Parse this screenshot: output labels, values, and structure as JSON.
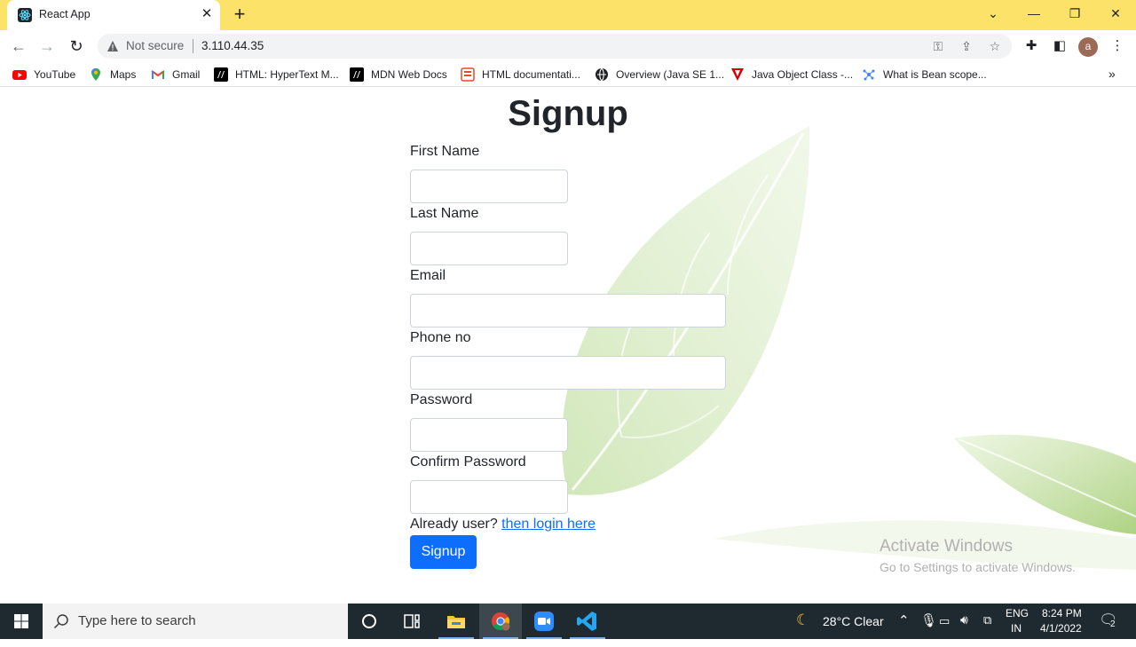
{
  "browser": {
    "tab_title": "React App",
    "security_label": "Not secure",
    "url": "3.110.44.35"
  },
  "bookmarks": [
    {
      "label": "YouTube",
      "icon": "youtube-icon"
    },
    {
      "label": "Maps",
      "icon": "maps-icon"
    },
    {
      "label": "Gmail",
      "icon": "gmail-icon"
    },
    {
      "label": "HTML: HyperText M...",
      "icon": "mdn-icon"
    },
    {
      "label": "MDN Web Docs",
      "icon": "mdn-icon"
    },
    {
      "label": "HTML documentati...",
      "icon": "html-doc-icon"
    },
    {
      "label": "Overview (Java SE 1...",
      "icon": "java-icon"
    },
    {
      "label": "Java Object Class -...",
      "icon": "javatpoint-icon"
    },
    {
      "label": "What is Bean scope...",
      "icon": "bean-icon"
    }
  ],
  "form": {
    "title": "Signup",
    "fields": [
      {
        "label": "First Name",
        "value": ""
      },
      {
        "label": "Last Name",
        "value": ""
      },
      {
        "label": "Email",
        "value": ""
      },
      {
        "label": "Phone no",
        "value": ""
      },
      {
        "label": "Password",
        "value": ""
      },
      {
        "label": "Confirm Password",
        "value": ""
      }
    ],
    "already_text": "Already user?",
    "login_link": "then login here",
    "submit_label": "Signup"
  },
  "watermark": {
    "line1": "Activate Windows",
    "line2": "Go to Settings to activate Windows."
  },
  "taskbar": {
    "search_placeholder": "Type here to search",
    "weather": "28°C  Clear",
    "lang_line1": "ENG",
    "lang_line2": "IN",
    "time": "8:24 PM",
    "date": "4/1/2022",
    "notification_count": "2"
  },
  "colors": {
    "tab_strip": "#fde26a",
    "primary": "#0d6efd",
    "taskbar": "#1f2a30"
  }
}
